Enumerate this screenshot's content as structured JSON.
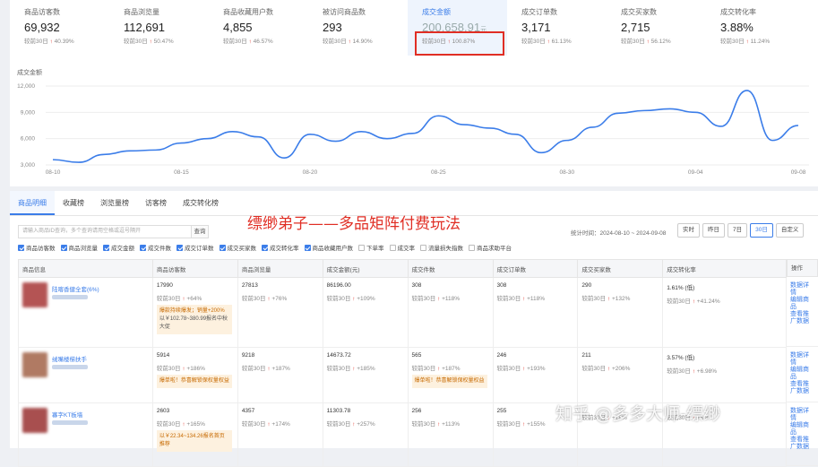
{
  "stats": [
    {
      "label": "商品访客数",
      "value": "69,932",
      "cmp": "较前30日",
      "delta": "40.39%"
    },
    {
      "label": "商品浏览量",
      "value": "112,691",
      "cmp": "较前30日",
      "delta": "50.47%"
    },
    {
      "label": "商品收藏用户数",
      "value": "4,855",
      "cmp": "较前30日",
      "delta": "46.57%"
    },
    {
      "label": "被访问商品数",
      "value": "293",
      "cmp": "较前30日",
      "delta": "14.90%"
    },
    {
      "label": "成交金额",
      "value": "200,658.91",
      "unit": "元",
      "cmp": "较前30日",
      "delta": "100.87%"
    },
    {
      "label": "成交订单数",
      "value": "3,171",
      "cmp": "较前30日",
      "delta": "61.13%"
    },
    {
      "label": "成交买家数",
      "value": "2,715",
      "cmp": "较前30日",
      "delta": "56.12%"
    },
    {
      "label": "成交转化率",
      "value": "3.88%",
      "cmp": "较前30日",
      "delta": "11.24%"
    }
  ],
  "chart_data": {
    "type": "line",
    "title": "成交金额",
    "yticks": [
      "3,000",
      "6,000",
      "9,000",
      "12,000"
    ],
    "ylim": [
      3000,
      12000
    ],
    "xticks": [
      "08-10",
      "08-15",
      "08-20",
      "08-25",
      "08-30",
      "09-04",
      "09-08"
    ],
    "x": [
      "08-10",
      "08-11",
      "08-12",
      "08-13",
      "08-14",
      "08-15",
      "08-16",
      "08-17",
      "08-18",
      "08-19",
      "08-20",
      "08-21",
      "08-22",
      "08-23",
      "08-24",
      "08-25",
      "08-26",
      "08-27",
      "08-28",
      "08-29",
      "08-30",
      "08-31",
      "09-01",
      "09-02",
      "09-03",
      "09-04",
      "09-05",
      "09-06",
      "09-07",
      "09-08"
    ],
    "values": [
      3600,
      3300,
      4200,
      4600,
      4700,
      5500,
      6000,
      6800,
      6200,
      3800,
      6500,
      5700,
      6800,
      6000,
      6600,
      8600,
      7600,
      7200,
      6500,
      4400,
      5800,
      7300,
      8900,
      9200,
      9400,
      9000,
      7400,
      11500,
      5800,
      7500
    ],
    "color": "#3b7de9"
  },
  "tabs": [
    "商品明细",
    "收藏榜",
    "浏览量榜",
    "访客榜",
    "成交转化榜"
  ],
  "search": {
    "placeholder": "请输入商品ID查询，多个查询请用空格或逗号隔开",
    "button": "查询"
  },
  "watermark": "缥缈弟子——多品矩阵付费玩法",
  "range": "统计时间：2024-08-10 ~ 2024-09-08",
  "range_buttons": [
    "实时",
    "昨日",
    "7日",
    "30日",
    "自定义"
  ],
  "checks": [
    {
      "label": "商品访客数",
      "on": true
    },
    {
      "label": "商品浏览量",
      "on": true
    },
    {
      "label": "成交金额",
      "on": true
    },
    {
      "label": "成交件数",
      "on": true
    },
    {
      "label": "成交订单数",
      "on": true
    },
    {
      "label": "成交买家数",
      "on": true
    },
    {
      "label": "成交转化率",
      "on": true
    },
    {
      "label": "商品收藏用户数",
      "on": true
    },
    {
      "label": "下单率",
      "on": false
    },
    {
      "label": "成交率",
      "on": false
    },
    {
      "label": "流量损失指数",
      "on": false
    },
    {
      "label": "商品求助平台",
      "on": false
    }
  ],
  "columns": [
    "商品信息",
    "商品访客数",
    "商品浏览量",
    "成交金额(元)",
    "成交件数",
    "成交订单数",
    "成交买家数",
    "成交转化率"
  ],
  "op_header": "操作",
  "rows": [
    {
      "name": "陆喀香健全套(6%)",
      "thumb": "#b45454",
      "cells": [
        [
          "17990",
          "+64%"
        ],
        [
          "27813",
          "+76%"
        ],
        [
          "86196.00",
          "+109%"
        ],
        [
          "308",
          "+118%"
        ],
        [
          "308",
          "+118%"
        ],
        [
          "290",
          "+132%"
        ],
        [
          "1.61% (低)",
          "+41.24%"
        ]
      ],
      "tip1": "爆款持续爆发；销量+200%",
      "tip2": "以￥102.78~380.99报名中秋大促",
      "ops": [
        "数据详情",
        "编辑商品",
        "查看推广数据"
      ]
    },
    {
      "name": "绒嘴楼梯扶手",
      "thumb": "#b07a63",
      "cells": [
        [
          "5914",
          "+186%"
        ],
        [
          "9218",
          "+187%"
        ],
        [
          "14673.72",
          "+185%"
        ],
        [
          "565",
          "+187%"
        ],
        [
          "246",
          "+193%"
        ],
        [
          "211",
          "+206%"
        ],
        [
          "3.57% (低)",
          "+6.98%"
        ]
      ],
      "tip1": "爆单啦！恭喜解锁保权量权益",
      "tip2": "",
      "ops": [
        "数据详情",
        "编辑商品",
        "查看推广数据"
      ]
    },
    {
      "name": "寡字KT板墙",
      "thumb": "#a84f4f",
      "cells": [
        [
          "2603",
          "+165%"
        ],
        [
          "4357",
          "+174%"
        ],
        [
          "11303.78",
          "+257%"
        ],
        [
          "256",
          "+113%"
        ],
        [
          "255",
          "+155%"
        ],
        [
          "",
          "+18%"
        ],
        [
          "",
          "+6.8"
        ]
      ],
      "tip1": "以￥22.34~134.26报名首页推荐",
      "tip2": "",
      "ops": [
        "数据详情",
        "编辑商品",
        "查看推广数据"
      ]
    }
  ],
  "cmp_label": "较前30日",
  "zhihu": "知乎 @多多大师-缥缈"
}
